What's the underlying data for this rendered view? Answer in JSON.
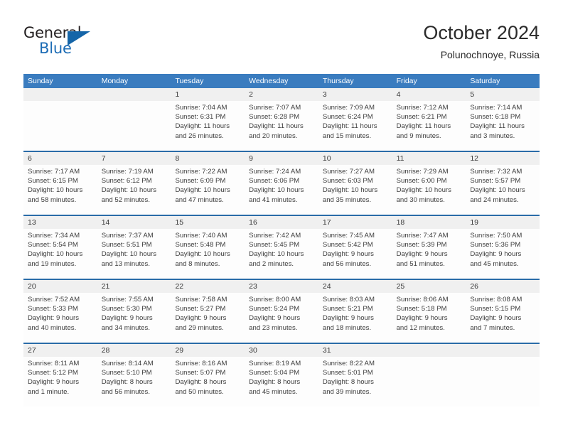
{
  "brand": {
    "name_top": "General",
    "name_bottom": "Blue",
    "triangle_icon": "triangle-icon",
    "accent_color": "#1565a8"
  },
  "header": {
    "title": "October 2024",
    "subtitle": "Polunochnoye, Russia"
  },
  "colors": {
    "header_blue": "#3a7cbf",
    "divider_blue": "#2a6ca8",
    "number_band_gray": "#f0f0f0",
    "cell_white": "#fdfdfd",
    "text": "#3a3a3a"
  },
  "calendar": {
    "day_names": [
      "Sunday",
      "Monday",
      "Tuesday",
      "Wednesday",
      "Thursday",
      "Friday",
      "Saturday"
    ],
    "weeks": [
      [
        {
          "day": "",
          "lines": []
        },
        {
          "day": "",
          "lines": []
        },
        {
          "day": "1",
          "lines": [
            "Sunrise: 7:04 AM",
            "Sunset: 6:31 PM",
            "Daylight: 11 hours",
            "and 26 minutes."
          ]
        },
        {
          "day": "2",
          "lines": [
            "Sunrise: 7:07 AM",
            "Sunset: 6:28 PM",
            "Daylight: 11 hours",
            "and 20 minutes."
          ]
        },
        {
          "day": "3",
          "lines": [
            "Sunrise: 7:09 AM",
            "Sunset: 6:24 PM",
            "Daylight: 11 hours",
            "and 15 minutes."
          ]
        },
        {
          "day": "4",
          "lines": [
            "Sunrise: 7:12 AM",
            "Sunset: 6:21 PM",
            "Daylight: 11 hours",
            "and 9 minutes."
          ]
        },
        {
          "day": "5",
          "lines": [
            "Sunrise: 7:14 AM",
            "Sunset: 6:18 PM",
            "Daylight: 11 hours",
            "and 3 minutes."
          ]
        }
      ],
      [
        {
          "day": "6",
          "lines": [
            "Sunrise: 7:17 AM",
            "Sunset: 6:15 PM",
            "Daylight: 10 hours",
            "and 58 minutes."
          ]
        },
        {
          "day": "7",
          "lines": [
            "Sunrise: 7:19 AM",
            "Sunset: 6:12 PM",
            "Daylight: 10 hours",
            "and 52 minutes."
          ]
        },
        {
          "day": "8",
          "lines": [
            "Sunrise: 7:22 AM",
            "Sunset: 6:09 PM",
            "Daylight: 10 hours",
            "and 47 minutes."
          ]
        },
        {
          "day": "9",
          "lines": [
            "Sunrise: 7:24 AM",
            "Sunset: 6:06 PM",
            "Daylight: 10 hours",
            "and 41 minutes."
          ]
        },
        {
          "day": "10",
          "lines": [
            "Sunrise: 7:27 AM",
            "Sunset: 6:03 PM",
            "Daylight: 10 hours",
            "and 35 minutes."
          ]
        },
        {
          "day": "11",
          "lines": [
            "Sunrise: 7:29 AM",
            "Sunset: 6:00 PM",
            "Daylight: 10 hours",
            "and 30 minutes."
          ]
        },
        {
          "day": "12",
          "lines": [
            "Sunrise: 7:32 AM",
            "Sunset: 5:57 PM",
            "Daylight: 10 hours",
            "and 24 minutes."
          ]
        }
      ],
      [
        {
          "day": "13",
          "lines": [
            "Sunrise: 7:34 AM",
            "Sunset: 5:54 PM",
            "Daylight: 10 hours",
            "and 19 minutes."
          ]
        },
        {
          "day": "14",
          "lines": [
            "Sunrise: 7:37 AM",
            "Sunset: 5:51 PM",
            "Daylight: 10 hours",
            "and 13 minutes."
          ]
        },
        {
          "day": "15",
          "lines": [
            "Sunrise: 7:40 AM",
            "Sunset: 5:48 PM",
            "Daylight: 10 hours",
            "and 8 minutes."
          ]
        },
        {
          "day": "16",
          "lines": [
            "Sunrise: 7:42 AM",
            "Sunset: 5:45 PM",
            "Daylight: 10 hours",
            "and 2 minutes."
          ]
        },
        {
          "day": "17",
          "lines": [
            "Sunrise: 7:45 AM",
            "Sunset: 5:42 PM",
            "Daylight: 9 hours",
            "and 56 minutes."
          ]
        },
        {
          "day": "18",
          "lines": [
            "Sunrise: 7:47 AM",
            "Sunset: 5:39 PM",
            "Daylight: 9 hours",
            "and 51 minutes."
          ]
        },
        {
          "day": "19",
          "lines": [
            "Sunrise: 7:50 AM",
            "Sunset: 5:36 PM",
            "Daylight: 9 hours",
            "and 45 minutes."
          ]
        }
      ],
      [
        {
          "day": "20",
          "lines": [
            "Sunrise: 7:52 AM",
            "Sunset: 5:33 PM",
            "Daylight: 9 hours",
            "and 40 minutes."
          ]
        },
        {
          "day": "21",
          "lines": [
            "Sunrise: 7:55 AM",
            "Sunset: 5:30 PM",
            "Daylight: 9 hours",
            "and 34 minutes."
          ]
        },
        {
          "day": "22",
          "lines": [
            "Sunrise: 7:58 AM",
            "Sunset: 5:27 PM",
            "Daylight: 9 hours",
            "and 29 minutes."
          ]
        },
        {
          "day": "23",
          "lines": [
            "Sunrise: 8:00 AM",
            "Sunset: 5:24 PM",
            "Daylight: 9 hours",
            "and 23 minutes."
          ]
        },
        {
          "day": "24",
          "lines": [
            "Sunrise: 8:03 AM",
            "Sunset: 5:21 PM",
            "Daylight: 9 hours",
            "and 18 minutes."
          ]
        },
        {
          "day": "25",
          "lines": [
            "Sunrise: 8:06 AM",
            "Sunset: 5:18 PM",
            "Daylight: 9 hours",
            "and 12 minutes."
          ]
        },
        {
          "day": "26",
          "lines": [
            "Sunrise: 8:08 AM",
            "Sunset: 5:15 PM",
            "Daylight: 9 hours",
            "and 7 minutes."
          ]
        }
      ],
      [
        {
          "day": "27",
          "lines": [
            "Sunrise: 8:11 AM",
            "Sunset: 5:12 PM",
            "Daylight: 9 hours",
            "and 1 minute."
          ]
        },
        {
          "day": "28",
          "lines": [
            "Sunrise: 8:14 AM",
            "Sunset: 5:10 PM",
            "Daylight: 8 hours",
            "and 56 minutes."
          ]
        },
        {
          "day": "29",
          "lines": [
            "Sunrise: 8:16 AM",
            "Sunset: 5:07 PM",
            "Daylight: 8 hours",
            "and 50 minutes."
          ]
        },
        {
          "day": "30",
          "lines": [
            "Sunrise: 8:19 AM",
            "Sunset: 5:04 PM",
            "Daylight: 8 hours",
            "and 45 minutes."
          ]
        },
        {
          "day": "31",
          "lines": [
            "Sunrise: 8:22 AM",
            "Sunset: 5:01 PM",
            "Daylight: 8 hours",
            "and 39 minutes."
          ]
        },
        {
          "day": "",
          "lines": []
        },
        {
          "day": "",
          "lines": []
        }
      ]
    ]
  }
}
